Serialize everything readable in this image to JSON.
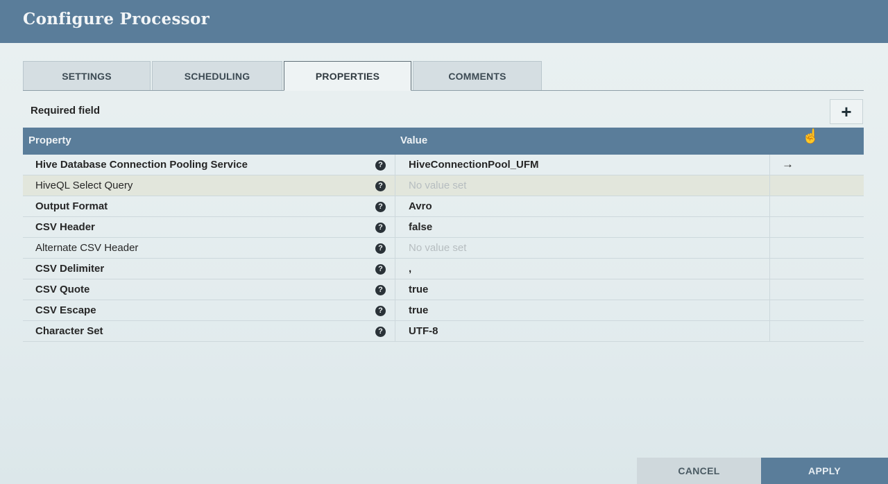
{
  "header": {
    "title": "Configure Processor"
  },
  "tabs": [
    {
      "label": "SETTINGS"
    },
    {
      "label": "SCHEDULING"
    },
    {
      "label": "PROPERTIES",
      "active": true
    },
    {
      "label": "COMMENTS"
    }
  ],
  "properties_panel": {
    "required_label": "Required field",
    "add_icon": "plus-icon",
    "columns": {
      "property": "Property",
      "value": "Value"
    },
    "rows": [
      {
        "name": "Hive Database Connection Pooling Service",
        "required": true,
        "value": "HiveConnectionPool_UFM",
        "has_arrow": true
      },
      {
        "name": "HiveQL Select Query",
        "required": false,
        "value": "No value set",
        "empty": true
      },
      {
        "name": "Output Format",
        "required": true,
        "value": "Avro"
      },
      {
        "name": "CSV Header",
        "required": true,
        "value": "false"
      },
      {
        "name": "Alternate CSV Header",
        "required": false,
        "value": "No value set",
        "empty": true
      },
      {
        "name": "CSV Delimiter",
        "required": true,
        "value": ","
      },
      {
        "name": "CSV Quote",
        "required": true,
        "value": "true"
      },
      {
        "name": "CSV Escape",
        "required": true,
        "value": "true"
      },
      {
        "name": "Character Set",
        "required": true,
        "value": "UTF-8"
      }
    ],
    "help_icon": "question-circle-icon",
    "arrow_icon": "arrow-right-icon"
  },
  "footer": {
    "cancel_label": "CANCEL",
    "apply_label": "APPLY"
  },
  "colors": {
    "header": "#5a7d9a",
    "table_header": "#5a7d9a",
    "apply": "#5a7d9a"
  }
}
